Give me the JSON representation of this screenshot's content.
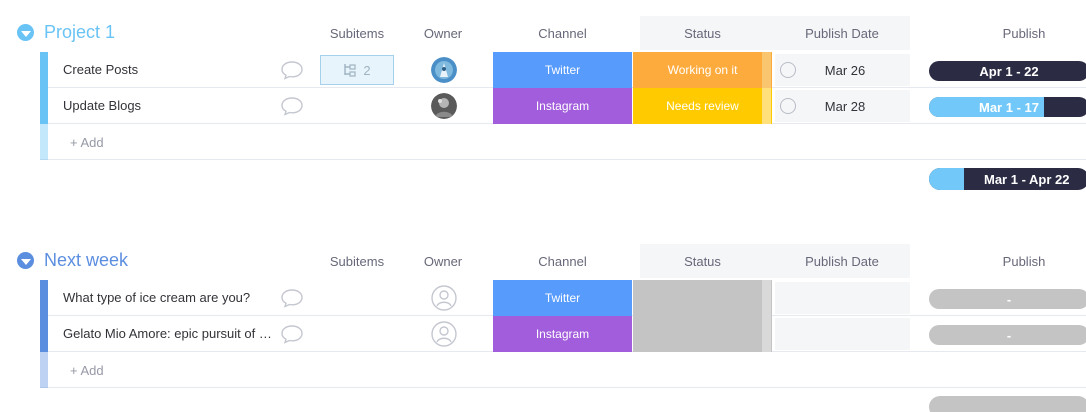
{
  "colors": {
    "group1": "#69c3f5",
    "group2": "#5c8ee0",
    "twitter": "#579bfc",
    "instagram": "#a25ddc",
    "working_on_it": "#fdab3d",
    "needs_review": "#ffcb00",
    "empty_status": "#c4c4c4",
    "timeline_dark": "#2b2c44",
    "timeline_light": "#72c8f8"
  },
  "columns": {
    "subitems": "Subitems",
    "owner": "Owner",
    "channel": "Channel",
    "status": "Status",
    "publish_date": "Publish Date",
    "publish": "Publish"
  },
  "groups": [
    {
      "title": "Project 1",
      "rows": [
        {
          "name": "Create Posts",
          "subitems_count": "2",
          "channel": "Twitter",
          "status": "Working on it",
          "publish_date": "Mar 26",
          "timeline": "Apr 1 - 22",
          "timeline_progress": 0
        },
        {
          "name": "Update Blogs",
          "channel": "Instagram",
          "status": "Needs review",
          "publish_date": "Mar 28",
          "timeline": "Mar 1 - 17",
          "timeline_progress": 0.72
        }
      ],
      "add_label": "+ Add",
      "summary_timeline": "Mar 1 - Apr 22",
      "summary_progress": 0.22
    },
    {
      "title": "Next week",
      "rows": [
        {
          "name": "What type of ice cream are you?",
          "channel": "Twitter",
          "timeline": "-"
        },
        {
          "name": "Gelato Mio Amore: epic pursuit of t…",
          "channel": "Instagram",
          "timeline": "-"
        }
      ],
      "add_label": "+ Add"
    }
  ]
}
